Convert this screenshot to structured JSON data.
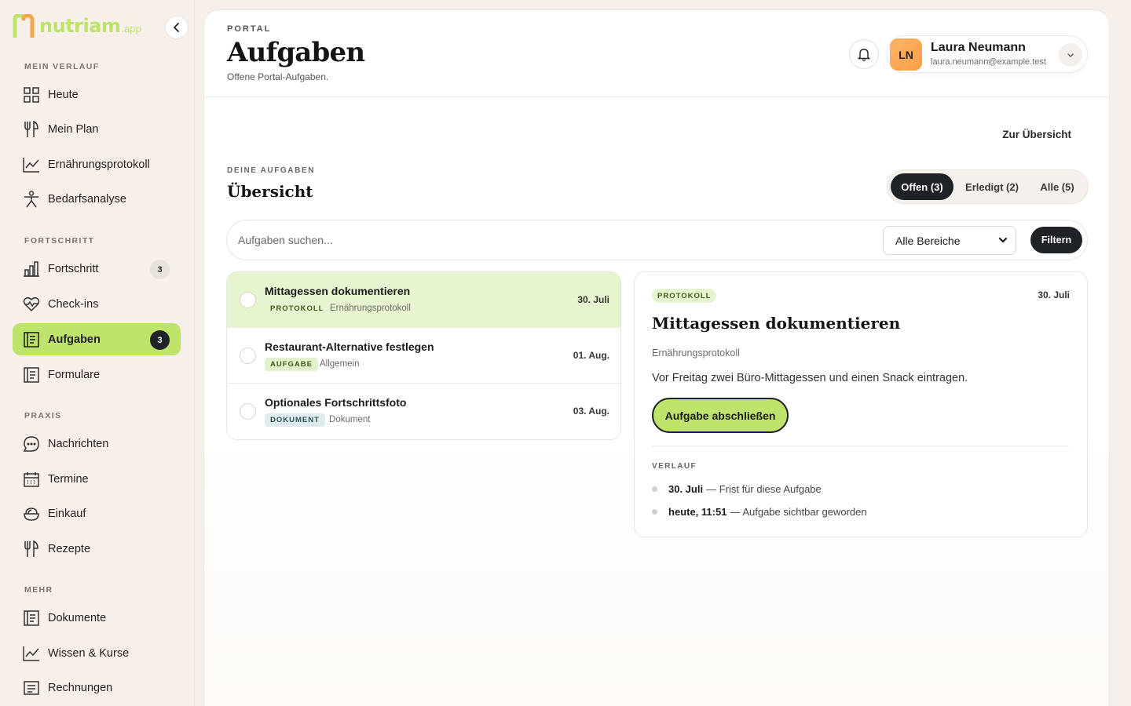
{
  "brand": {
    "name": "nutriam",
    "suffix": ".app",
    "color": "#bde36a"
  },
  "sidebar": {
    "sections": [
      {
        "label": "MEIN VERLAUF"
      },
      {
        "label": "FORTSCHRITT"
      },
      {
        "label": "PRAXIS"
      },
      {
        "label": "MEHR"
      }
    ],
    "items": [
      {
        "label": "Heute",
        "icon": "grid-icon"
      },
      {
        "label": "Mein Plan",
        "icon": "cutlery-icon"
      },
      {
        "label": "Ernährungsprotokoll",
        "icon": "chart-line-icon"
      },
      {
        "label": "Bedarfsanalyse",
        "icon": "person-icon"
      },
      {
        "label": "Fortschritt",
        "icon": "bar-chart-icon",
        "badge": "3"
      },
      {
        "label": "Check-ins",
        "icon": "heart-pulse-icon"
      },
      {
        "label": "Aufgaben",
        "icon": "task-list-icon",
        "badge": "3",
        "active": true
      },
      {
        "label": "Formulare",
        "icon": "form-icon"
      },
      {
        "label": "Nachrichten",
        "icon": "chat-icon"
      },
      {
        "label": "Termine",
        "icon": "calendar-icon"
      },
      {
        "label": "Einkauf",
        "icon": "bowl-icon"
      },
      {
        "label": "Rezepte",
        "icon": "cutlery-icon"
      },
      {
        "label": "Dokumente",
        "icon": "document-icon"
      },
      {
        "label": "Wissen & Kurse",
        "icon": "chart-line-icon"
      },
      {
        "label": "Rechnungen",
        "icon": "receipt-icon"
      }
    ]
  },
  "header": {
    "eyebrow": "PORTAL",
    "title": "Aufgaben",
    "subtitle": "Offene Portal-Aufgaben.",
    "user": {
      "initials": "LN",
      "name": "Laura Neumann",
      "email": "laura.neumann@example.test"
    }
  },
  "main": {
    "back_link": "Zur Übersicht",
    "section_eyebrow": "DEINE AUFGABEN",
    "section_title": "Übersicht",
    "tabs": [
      {
        "label": "Offen (3)",
        "active": true
      },
      {
        "label": "Erledigt (2)"
      },
      {
        "label": "Alle (5)"
      }
    ],
    "search": {
      "placeholder": "Aufgaben suchen...",
      "value": ""
    },
    "area_select": {
      "selected": "Alle Bereiche"
    },
    "filter_label": "Filtern"
  },
  "tasks": [
    {
      "title": "Mittagessen dokumentieren",
      "tag": "PROTOKOLL",
      "category": "Ernährungsprotokoll",
      "date": "30. Juli",
      "selected": true
    },
    {
      "title": "Restaurant-Alternative festlegen",
      "tag": "AUFGABE",
      "category": "Allgemein",
      "date": "01. Aug."
    },
    {
      "title": "Optionales Fortschrittsfoto",
      "tag": "DOKUMENT",
      "category": "Dokument",
      "date": "03. Aug."
    }
  ],
  "detail": {
    "tag": "PROTOKOLL",
    "date": "30. Juli",
    "title": "Mittagessen dokumentieren",
    "category": "Ernährungsprotokoll",
    "description": "Vor Freitag zwei Büro-Mittagessen und einen Snack eintragen.",
    "complete_label": "Aufgabe abschließen",
    "history_label": "VERLAUF",
    "history": [
      {
        "when": "30. Juli",
        "text": "— Frist für diese Aufgabe"
      },
      {
        "when": "heute, 11:51",
        "text": "— Aufgabe sichtbar geworden"
      }
    ]
  }
}
